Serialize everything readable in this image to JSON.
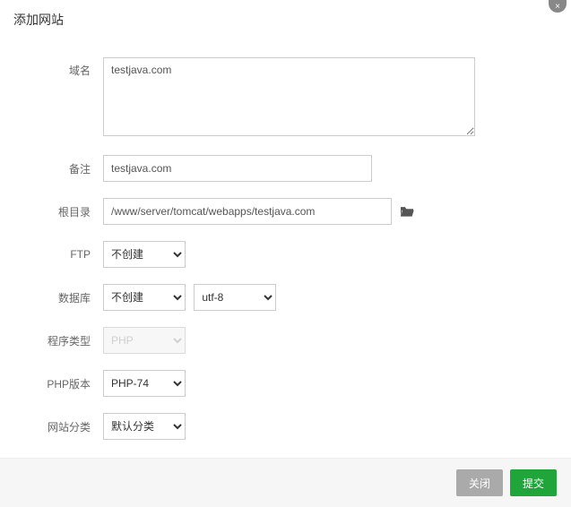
{
  "header": {
    "title": "添加网站"
  },
  "form": {
    "domain": {
      "label": "域名",
      "value": "testjava.com"
    },
    "remark": {
      "label": "备注",
      "value": "testjava.com"
    },
    "root": {
      "label": "根目录",
      "value": "/www/server/tomcat/webapps/testjava.com"
    },
    "ftp": {
      "label": "FTP",
      "value": "不创建"
    },
    "database": {
      "label": "数据库",
      "value": "不创建",
      "charset": "utf-8"
    },
    "program_type": {
      "label": "程序类型",
      "value": "PHP"
    },
    "php_version": {
      "label": "PHP版本",
      "value": "PHP-74"
    },
    "site_category": {
      "label": "网站分类",
      "value": "默认分类"
    }
  },
  "footer": {
    "cancel": "关闭",
    "submit": "提交"
  }
}
